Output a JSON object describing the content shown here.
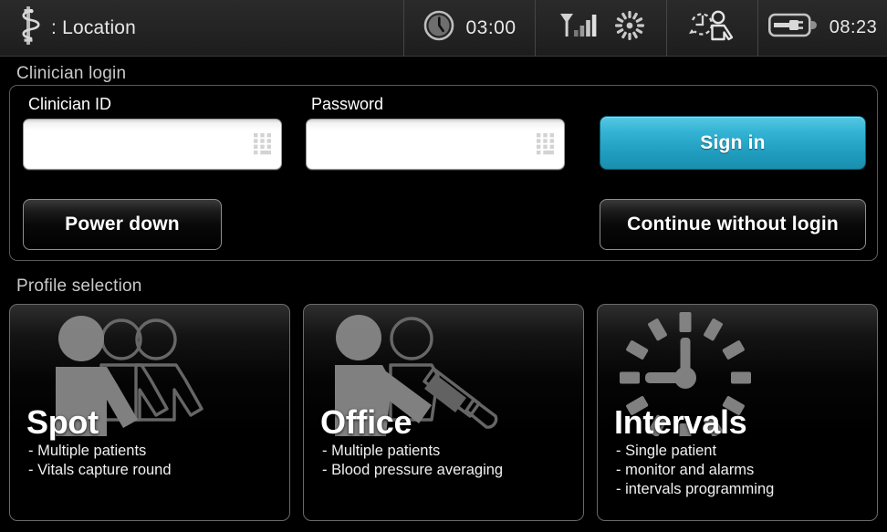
{
  "statusbar": {
    "location_icon": "rod-of-asclepius-icon",
    "location_text": ": Location",
    "clock_icon": "clock-icon",
    "clock_value": "03:00",
    "radio_icon": "wifi-signal-icon",
    "activity_icon": "spinner-icon",
    "recall_icon": "patient-recall-clock-icon",
    "battery_icon": "battery-charging-icon",
    "battery_value": "08:23"
  },
  "login": {
    "section_label": "Clinician login",
    "clinician_id": {
      "label": "Clinician ID",
      "value": "",
      "placeholder": "",
      "keypad_icon": "keypad-icon"
    },
    "password": {
      "label": "Password",
      "value": "",
      "placeholder": "",
      "keypad_icon": "keypad-icon"
    },
    "sign_in_label": "Sign in",
    "power_down_label": "Power down",
    "continue_label": "Continue without login"
  },
  "profiles": {
    "section_label": "Profile selection",
    "cards": [
      {
        "title": "Spot",
        "icon": "multiple-patients-icon",
        "lines": [
          "- Multiple patients",
          "- Vitals capture round"
        ]
      },
      {
        "title": "Office",
        "icon": "patients-bp-cuff-icon",
        "lines": [
          "- Multiple patients",
          "- Blood pressure averaging"
        ]
      },
      {
        "title": "Intervals",
        "icon": "clock-dial-icon",
        "lines": [
          "- Single patient",
          "- monitor and alarms",
          "- intervals programming"
        ]
      }
    ]
  },
  "colors": {
    "accent": "#34b4d4",
    "background": "#000000",
    "statusbar": "#242424",
    "border": "#5a5a5a",
    "icon_gray": "#8c8c8c",
    "text": "#ffffff"
  }
}
